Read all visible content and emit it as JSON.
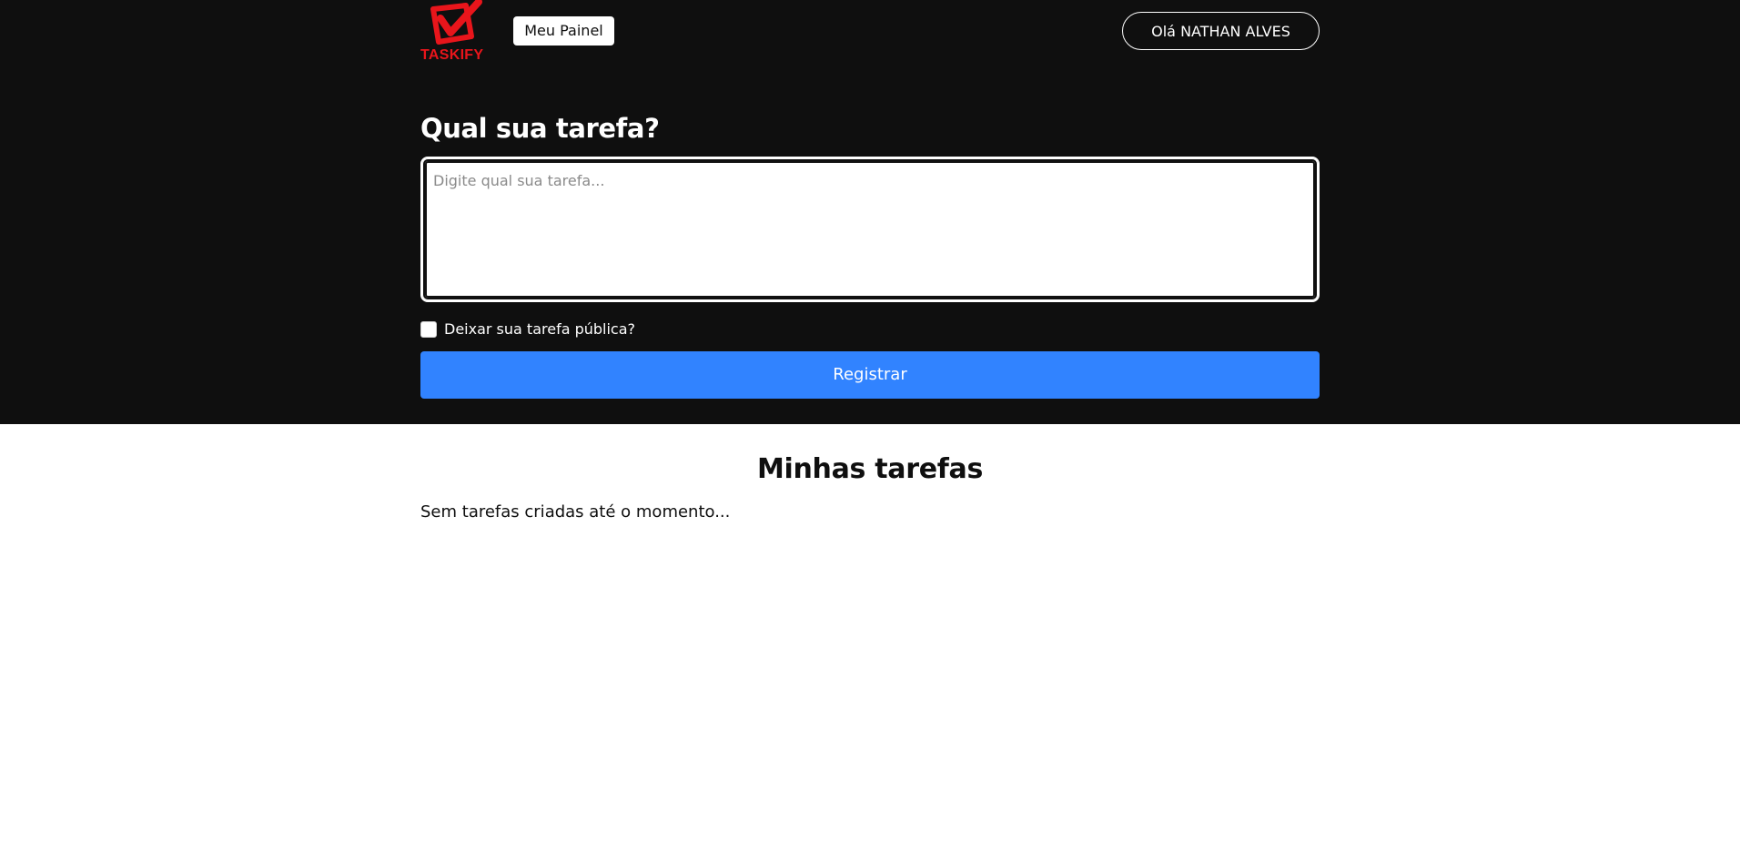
{
  "header": {
    "logo_text": "TASKIFY",
    "panel_button_label": "Meu Painel",
    "user_greeting": "Olá NATHAN ALVES"
  },
  "form": {
    "title": "Qual sua tarefa?",
    "task_input": {
      "value": "",
      "placeholder": "Digite qual sua tarefa..."
    },
    "public_checkbox": {
      "label": "Deixar sua tarefa pública?",
      "checked": false
    },
    "submit_label": "Registrar"
  },
  "tasks": {
    "title": "Minhas tarefas",
    "empty_message": "Sem tarefas criadas até o momento...",
    "items": []
  },
  "colors": {
    "header_background": "#0f0f0f",
    "brand_red": "#e8151b",
    "primary_blue": "#3183ff"
  },
  "icons": {
    "logo": "checkbox-check-icon"
  }
}
